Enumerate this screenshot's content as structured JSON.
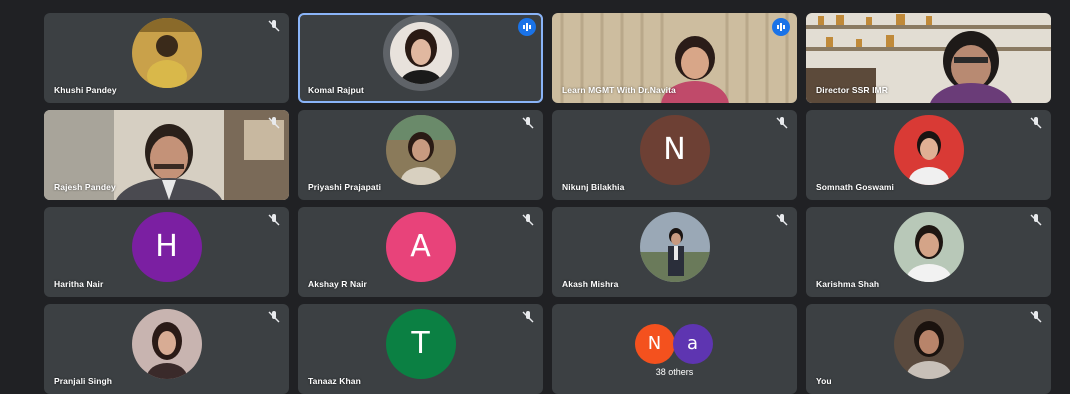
{
  "tiles": [
    {
      "name": "Khushi Pandey",
      "kind": "photo",
      "muted": true,
      "photo_color": "#8a6a2a"
    },
    {
      "name": "Komal Rajput",
      "kind": "photo-ring",
      "muted": false,
      "speaking": true,
      "photo_color": "#e8d0c8"
    },
    {
      "name": "Learn MGMT With Dr.Navita",
      "kind": "video",
      "muted": false,
      "speaking": true,
      "video_color": "#c9b79a"
    },
    {
      "name": "Director SSR IMR",
      "kind": "video",
      "muted": false,
      "video_color": "#d5d0c5"
    },
    {
      "name": "Rajesh Pandey",
      "kind": "video",
      "muted": true,
      "video_color": "#8a8a82"
    },
    {
      "name": "Priyashi Prajapati",
      "kind": "photo",
      "muted": true,
      "photo_color": "#6b5a48"
    },
    {
      "name": "Nikunj Bilakhia",
      "kind": "letter",
      "letter": "N",
      "letter_bg": "#6d4034",
      "muted": true
    },
    {
      "name": "Somnath Goswami",
      "kind": "photo",
      "muted": true,
      "photo_color": "#d93a35"
    },
    {
      "name": "Haritha Nair",
      "kind": "letter",
      "letter": "H",
      "letter_bg": "#7b1fa2",
      "muted": true
    },
    {
      "name": "Akshay R Nair",
      "kind": "letter",
      "letter": "A",
      "letter_bg": "#e8437a",
      "muted": true
    },
    {
      "name": "Akash Mishra",
      "kind": "photo",
      "muted": true,
      "photo_color": "#7d8a99"
    },
    {
      "name": "Karishma Shah",
      "kind": "photo",
      "muted": true,
      "photo_color": "#9fb4a8"
    },
    {
      "name": "Pranjali Singh",
      "kind": "photo",
      "muted": true,
      "photo_color": "#a38a87"
    },
    {
      "name": "Tanaaz Khan",
      "kind": "letter",
      "letter": "T",
      "letter_bg": "#0b8043",
      "muted": true
    },
    {
      "name": "",
      "kind": "others",
      "others_label": "38 others",
      "mini": [
        {
          "letter": "N",
          "bg": "#f4511e"
        },
        {
          "letter": "a",
          "bg": "#5e35b1"
        }
      ]
    },
    {
      "name": "You",
      "kind": "photo",
      "muted": true,
      "photo_color": "#4a3c34"
    }
  ],
  "colors": {
    "background": "#202124",
    "tile": "#3c4043",
    "active_outline": "#8ab4f8",
    "speaking_badge": "#1a73e8"
  }
}
